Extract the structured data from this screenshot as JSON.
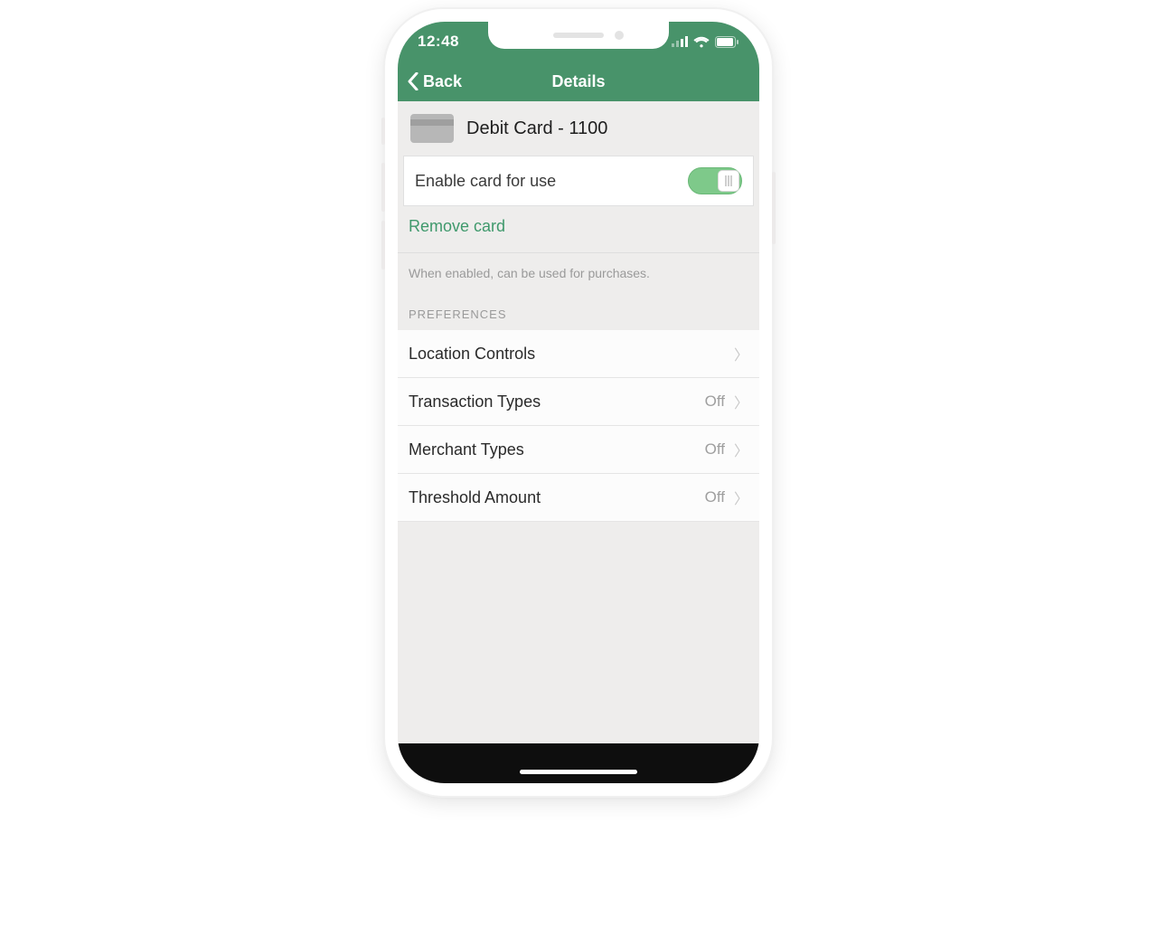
{
  "status": {
    "time": "12:48"
  },
  "nav": {
    "back_label": "Back",
    "title": "Details"
  },
  "card": {
    "title": "Debit Card - 1100"
  },
  "enable": {
    "label": "Enable card for use",
    "on": true
  },
  "remove": {
    "label": "Remove card"
  },
  "helper": {
    "text": "When enabled, can be used for purchases."
  },
  "section": {
    "preferences_label": "PREFERENCES"
  },
  "prefs": [
    {
      "label": "Location Controls",
      "status": ""
    },
    {
      "label": "Transaction Types",
      "status": "Off"
    },
    {
      "label": "Merchant Types",
      "status": "Off"
    },
    {
      "label": "Threshold Amount",
      "status": "Off"
    }
  ]
}
